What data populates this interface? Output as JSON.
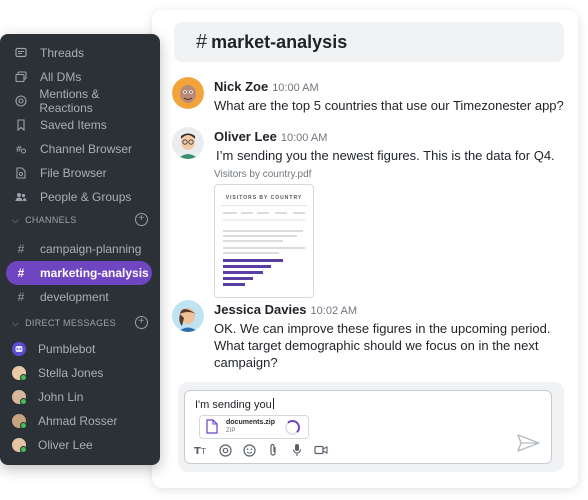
{
  "sidebar": {
    "items": [
      {
        "label": "Threads",
        "icon": "threads-icon"
      },
      {
        "label": "All DMs",
        "icon": "all-dms-icon"
      },
      {
        "label": "Mentions & Reactions",
        "icon": "at-icon"
      },
      {
        "label": "Saved Items",
        "icon": "bookmark-icon"
      },
      {
        "label": "Channel Browser",
        "icon": "channel-browser-icon"
      },
      {
        "label": "File Browser",
        "icon": "file-browser-icon"
      },
      {
        "label": "People & Groups",
        "icon": "people-icon"
      }
    ],
    "channels_header": "CHANNELS",
    "channels": [
      {
        "label": "campaign-planning",
        "active": false
      },
      {
        "label": "marketing-analysis",
        "active": true
      },
      {
        "label": "development",
        "active": false
      }
    ],
    "dm_header": "DIRECT MESSAGES",
    "dms": [
      {
        "label": "Pumblebot",
        "online": false
      },
      {
        "label": "Stella Jones",
        "online": true
      },
      {
        "label": "John Lin",
        "online": true
      },
      {
        "label": "Ahmad Rosser",
        "online": true
      },
      {
        "label": "Oliver Lee",
        "online": true
      }
    ]
  },
  "channel": {
    "hash": "#",
    "name": "market-analysis"
  },
  "messages": [
    {
      "name": "Nick Zoe",
      "time": "10:00 AM",
      "text": "What are the top 5 countries that use our Timezonester app?"
    },
    {
      "name": "Oliver Lee",
      "time": "10:00 AM",
      "text": "I’m sending you the newest figures. This is the data for Q4."
    },
    {
      "name": "Jessica Davies",
      "time": "10:02 AM",
      "text": "OK. We can improve these figures in the upcoming period. What target demographic should we focus on in the next campaign?"
    }
  ],
  "attachment": {
    "label": "Visitors by country.pdf",
    "preview_title": "VISITORS BY COUNTRY"
  },
  "composer": {
    "value": "I'm sending you",
    "file_name": "documents.zip",
    "file_type": "ZIP",
    "tools": [
      "text-format-icon",
      "mention-icon",
      "emoji-icon",
      "paperclip-icon",
      "microphone-icon",
      "video-icon"
    ]
  },
  "colors": {
    "sidebar_bg": "#2b3136",
    "accent": "#7045c2",
    "online": "#3fbf5c"
  }
}
